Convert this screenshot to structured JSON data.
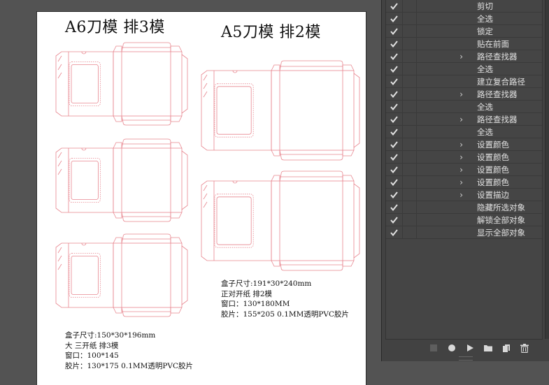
{
  "artboard": {
    "a6": {
      "title": "A6刀模 排3模",
      "specs": [
        "盒子尺寸:150*30*196mm",
        "大 三开纸 排3模",
        "窗口：100*145",
        "胶片：130*175  0.1MM透明PVC胶片"
      ]
    },
    "a5": {
      "title": "A5刀模 排2模",
      "specs": [
        "盒子尺寸:191*30*240mm",
        "正对开纸 排2模",
        "窗口：130*180MM",
        "胶片：155*205  0.1MM透明PVC胶片"
      ]
    }
  },
  "colors": {
    "dieline": "#e8868f",
    "panel_bg": "#424242",
    "check": "#e0e0e0"
  },
  "actions": [
    {
      "label": "剪切",
      "expandable": false
    },
    {
      "label": "全选",
      "expandable": false
    },
    {
      "label": "锁定",
      "expandable": false
    },
    {
      "label": "贴在前面",
      "expandable": false
    },
    {
      "label": "路径查找器",
      "expandable": true
    },
    {
      "label": "全选",
      "expandable": false
    },
    {
      "label": "建立复合路径",
      "expandable": false
    },
    {
      "label": "路径查找器",
      "expandable": true
    },
    {
      "label": "全选",
      "expandable": false
    },
    {
      "label": "路径查找器",
      "expandable": true
    },
    {
      "label": "全选",
      "expandable": false
    },
    {
      "label": "设置颜色",
      "expandable": true
    },
    {
      "label": "设置颜色",
      "expandable": true
    },
    {
      "label": "设置颜色",
      "expandable": true
    },
    {
      "label": "设置颜色",
      "expandable": true
    },
    {
      "label": "设置描边",
      "expandable": true
    },
    {
      "label": "隐藏所选对象",
      "expandable": false
    },
    {
      "label": "解锁全部对象",
      "expandable": false
    },
    {
      "label": "显示全部对象",
      "expandable": false
    }
  ],
  "toolbar": {
    "icons": [
      "stop-icon",
      "record-icon",
      "play-icon",
      "new-set-folder-icon",
      "new-action-icon",
      "trash-icon"
    ]
  }
}
